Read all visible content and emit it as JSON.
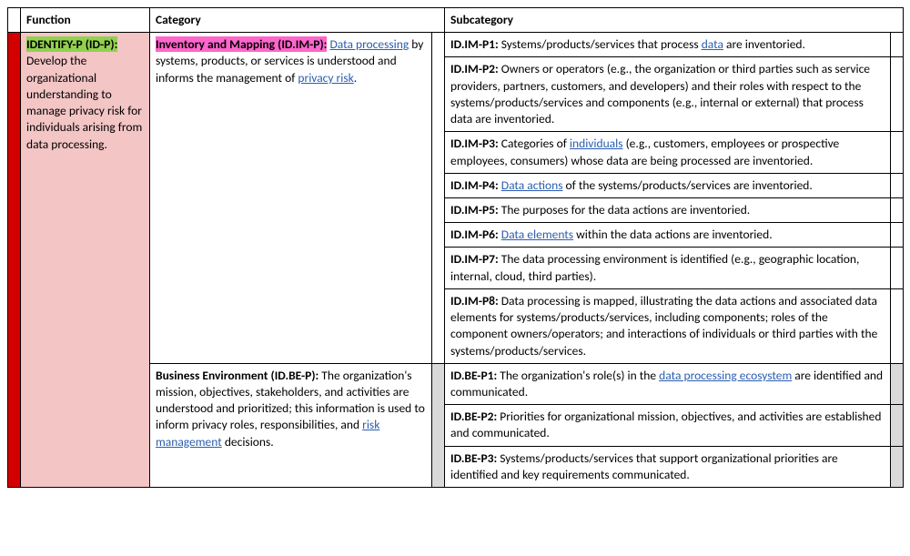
{
  "headers": {
    "c1": "Function",
    "c2": "Category",
    "c3": "Subcategory"
  },
  "function": {
    "code": "IDENTIFY-P (ID-P):",
    "text": " Develop the organizational understanding to manage privacy risk for individuals arising from data processing."
  },
  "cat_im": {
    "code": "Inventory and Mapping (ID.IM-P):",
    "pre": " ",
    "link1": "Data processing",
    "mid": " by systems, products, or services is understood and informs the management of ",
    "link2": "privacy risk",
    "post": "."
  },
  "cat_be": {
    "code": "Business Environment (ID.BE-P):",
    "text1": " The organization's mission, objectives, stakeholders, and activities are understood and prioritized; this information is used to inform privacy roles, responsibilities, and ",
    "link": "risk management",
    "text2": " decisions."
  },
  "im": {
    "p1": {
      "code": "ID.IM-P1:",
      "a": " Systems/products/services that process ",
      "link": "data",
      "b": " are inventoried."
    },
    "p2": {
      "code": "ID.IM-P2:",
      "text": " Owners or operators (e.g., the organization or third parties such as service providers, partners, customers, and developers) and their roles with respect to the systems/products/services and components (e.g., internal or external) that process data are inventoried."
    },
    "p3": {
      "code": "ID.IM-P3:",
      "a": " Categories of ",
      "link": "individuals",
      "b": " (e.g., customers, employees or prospective employees, consumers) whose data are being processed are inventoried."
    },
    "p4": {
      "code": "ID.IM-P4:",
      "a": " ",
      "link": "Data actions",
      "b": " of the systems/products/services are inventoried."
    },
    "p5": {
      "code": "ID.IM-P5:",
      "text": " The purposes for the data actions are inventoried."
    },
    "p6": {
      "code": "ID.IM-P6:",
      "a": " ",
      "link": "Data elements",
      "b": " within the data actions are inventoried."
    },
    "p7": {
      "code": "ID.IM-P7:",
      "text": " The data processing environment is identified (e.g., geographic location, internal, cloud, third parties)."
    },
    "p8": {
      "code": "ID.IM-P8:",
      "text": " Data processing is mapped, illustrating the data actions and associated data elements for systems/products/services, including components; roles of the component owners/operators; and interactions of individuals or third parties with the systems/products/services."
    }
  },
  "be": {
    "p1": {
      "code": "ID.BE-P1:",
      "a": " The organization's role(s) in the ",
      "link": "data processing ecosystem",
      "b": " are identified and communicated."
    },
    "p2": {
      "code": "ID.BE-P2:",
      "text": " Priorities for organizational mission, objectives, and activities are established and communicated."
    },
    "p3": {
      "code": "ID.BE-P3:",
      "text": " Systems/products/services that support organizational priorities are identified and key requirements communicated."
    }
  }
}
